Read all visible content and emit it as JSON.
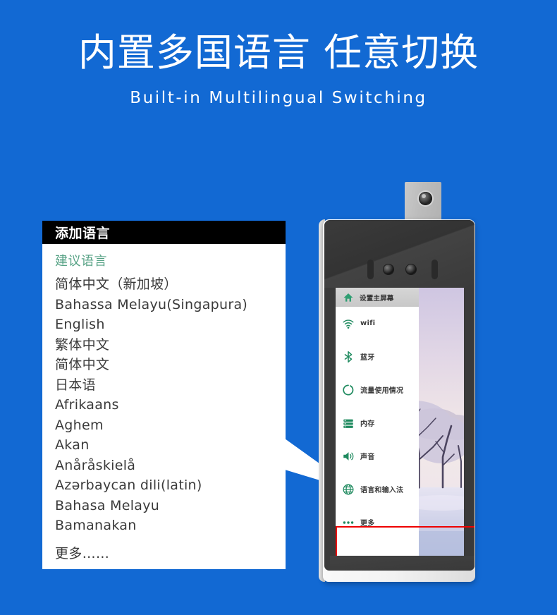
{
  "header": {
    "title_cn": "内置多国语言 任意切换",
    "title_en": "Built-in Multilingual Switching"
  },
  "colors": {
    "background_blue": "#1269D3",
    "panel_header_bg": "#000000",
    "section_label_green": "#55A184",
    "icon_green": "#1F8A5F",
    "highlight_red": "#EE0000",
    "text_dark": "#3A3A3A"
  },
  "lang_panel": {
    "header_title": "添加语言",
    "section_label": "建议语言",
    "languages": [
      "简体中文（新加坡）",
      "Bahassa Melayu(Singapura)",
      "English",
      "繁体中文",
      "简体中文",
      "日本语",
      "Afrikaans",
      "Aghem",
      "Akan",
      "Anåråskielå",
      "Azərbaycan dili(latin)",
      "Bahasa Melayu",
      "Bamanakan"
    ],
    "more_label": "更多……"
  },
  "device": {
    "settings": {
      "home_label": "设置主屏幕",
      "home_icon": "home-icon",
      "rows": [
        {
          "label": "wifi",
          "icon": "wifi-icon"
        },
        {
          "label": "蓝牙",
          "icon": "bluetooth-icon"
        },
        {
          "label": "流量使用情况",
          "icon": "data-usage-icon"
        },
        {
          "label": "内存",
          "icon": "storage-icon"
        },
        {
          "label": "声音",
          "icon": "sound-icon"
        },
        {
          "label": "语言和输入法",
          "icon": "globe-icon"
        },
        {
          "label": "更多",
          "icon": "more-dots-icon"
        }
      ],
      "highlighted_row_index": 5
    },
    "wallpaper_description": "winter-snow-trees-wallpaper"
  }
}
